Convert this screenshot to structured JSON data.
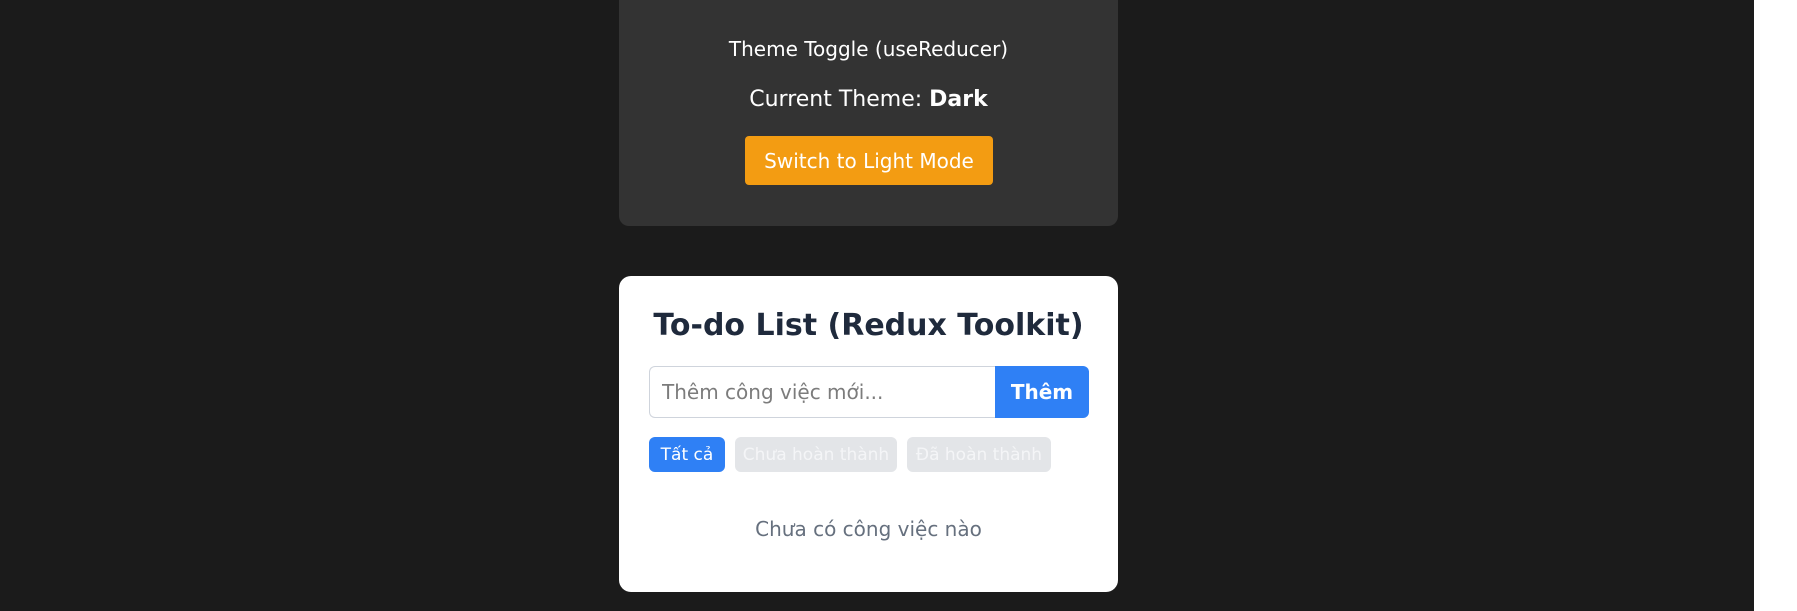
{
  "theme_card": {
    "title": "Theme Toggle (useReducer)",
    "current_label": "Current Theme: ",
    "current_value": "Dark",
    "switch_button_label": "Switch to Light Mode"
  },
  "todo_card": {
    "title": "To-do List (Redux Toolkit)",
    "input": {
      "placeholder": "Thêm công việc mới...",
      "value": ""
    },
    "add_button_label": "Thêm",
    "filters": [
      {
        "label": "Tất cả",
        "active": true
      },
      {
        "label": "Chưa hoàn thành",
        "active": false
      },
      {
        "label": "Đã hoàn thành",
        "active": false
      }
    ],
    "empty_message": "Chưa có công việc nào"
  },
  "colors": {
    "page_background": "#1b1b1b",
    "theme_card_background": "#333333",
    "switch_button": "#f39c12",
    "primary": "#2f80f5",
    "inactive_filter": "#e3e5e8",
    "title_text": "#1f2a3c"
  }
}
